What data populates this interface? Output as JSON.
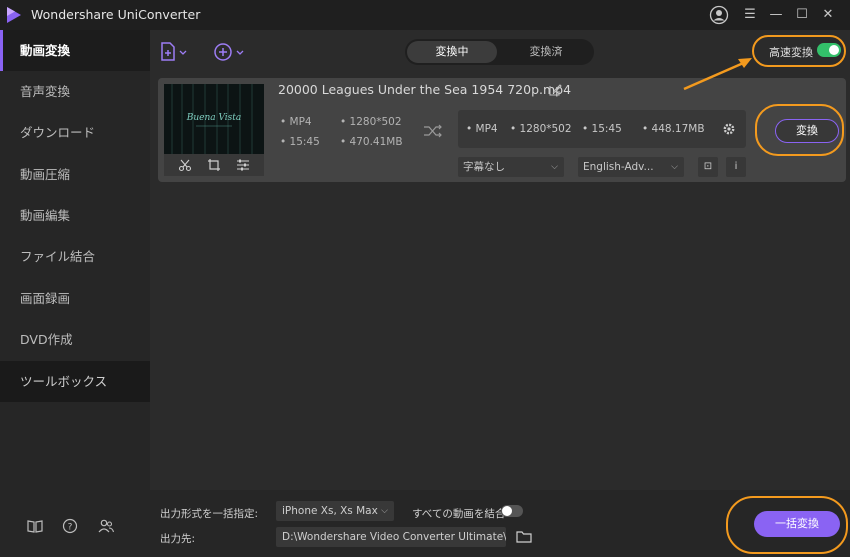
{
  "window": {
    "title": "Wondershare UniConverter"
  },
  "sidebar": {
    "items": [
      {
        "label": "動画変換",
        "active": true
      },
      {
        "label": "音声変換"
      },
      {
        "label": "ダウンロード"
      },
      {
        "label": "動画圧縮"
      },
      {
        "label": "動画編集"
      },
      {
        "label": "ファイル結合"
      },
      {
        "label": "画面録画"
      },
      {
        "label": "DVD作成"
      },
      {
        "label": "ツールボックス"
      }
    ],
    "bottom_icons": [
      "book-icon",
      "help-icon",
      "account-icon"
    ]
  },
  "toolbar": {
    "tabs": [
      {
        "label": "変換中",
        "active": true
      },
      {
        "label": "変換済"
      }
    ],
    "high_speed_label": "高速変換",
    "high_speed_on": true
  },
  "file": {
    "name": "20000 Leagues Under the Sea 1954 720p.mp4",
    "thumbnail_text": "Buena Vista",
    "source": {
      "format": "MP4",
      "resolution": "1280*502",
      "duration": "15:45",
      "size": "470.41MB"
    },
    "output": {
      "format": "MP4",
      "resolution": "1280*502",
      "duration": "15:45",
      "size": "448.17MB"
    },
    "subtitle": "字幕なし",
    "audio": "English-Adv...",
    "convert_label": "変換"
  },
  "bottom": {
    "format_label": "出力形式を一括指定:",
    "format_value": "iPhone Xs, Xs Max",
    "merge_label": "すべての動画を結合",
    "merge_on": false,
    "output_label": "出力先:",
    "output_path": "D:\\Wondershare Video Converter Ultimate\\Co",
    "batch_label": "一括変換"
  },
  "colors": {
    "accent": "#8a63f3",
    "annotation": "#f39a1e",
    "toggle_on": "#33c06a"
  }
}
